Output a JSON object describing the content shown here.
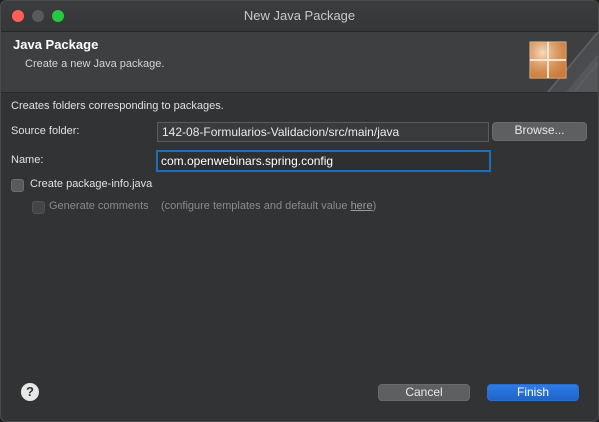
{
  "window": {
    "title": "New Java Package"
  },
  "header": {
    "title": "Java Package",
    "description": "Create a new Java package."
  },
  "body": {
    "intro": "Creates folders corresponding to packages."
  },
  "source_folder": {
    "label": "Source folder:",
    "value": "142-08-Formularios-Validacion/src/main/java",
    "browse_label": "Browse..."
  },
  "name_field": {
    "label": "Name:",
    "value": "com.openwebinars.spring.config"
  },
  "package_info": {
    "label": "Create package-info.java",
    "checked": false
  },
  "generate_comments": {
    "label": "Generate comments",
    "checked": false,
    "enabled": false,
    "hint_prefix": "(configure templates and default value ",
    "hint_link": "here",
    "hint_suffix": ")"
  },
  "footer": {
    "help_glyph": "?",
    "cancel_label": "Cancel",
    "finish_label": "Finish"
  },
  "colors": {
    "accent": "#1f63c8",
    "focus_ring": "#1f6fb8",
    "background": "#323335"
  }
}
